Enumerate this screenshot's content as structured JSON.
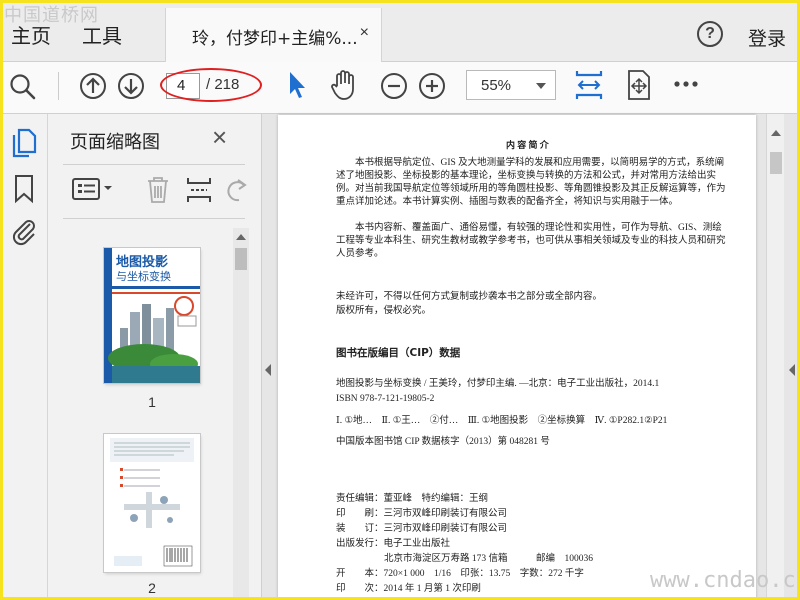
{
  "watermark_top": "中国道桥网",
  "watermark_bottom": "www.cndao.com",
  "menu": {
    "home": "主页",
    "tools": "工具",
    "login": "登录",
    "help_glyph": "?"
  },
  "tab": {
    "label": "玲，付梦印+主编%...",
    "close": "×"
  },
  "toolbar": {
    "current_page": "4",
    "total_pages": "/ 218",
    "zoom": "55%"
  },
  "panel": {
    "title": "页面缩略图",
    "close": "×",
    "thumb1_num": "1",
    "thumb2_num": "2"
  },
  "thumb1": {
    "title_line1": "地图投影",
    "title_line2": "与坐标变换"
  },
  "document": {
    "heading": "内 容 简 介",
    "para1": "本书根据导航定位、GIS 及大地测量学科的发展和应用需要，以简明易学的方式，系统阐述了地图投影、坐标投影的基本理论，坐标变换与转换的方法和公式，并对常用方法给出实例。对当前我国导航定位等领域所用的等角圆柱投影、等角圆锥投影及其正反解运算等，作为重点详加论述。本书计算实例、插图与数表的配备齐全，将知识与实用融于一体。",
    "para2": "本书内容新、覆盖面广、通俗易懂，有较强的理论性和实用性，可作为导航、GIS、测绘工程等专业本科生、研究生教材或教学参考书，也可供从事相关领域及专业的科技人员和研究人员参考。",
    "copy1": "未经许可，不得以任何方式复制或抄袭本书之部分或全部内容。",
    "copy2": "版权所有，侵权必究。",
    "cip_title": "图书在版编目（CIP）数据",
    "cip1": "地图投影与坐标变换 / 王美玲，付梦印主编. —北京：电子工业出版社，2014.1",
    "cip2": "ISBN 978-7-121-19805-2",
    "cip3": "Ⅰ. ①地…　Ⅱ. ①王…　②付…　Ⅲ. ①地图投影　②坐标换算　Ⅳ. ①P282.1②P21",
    "cip4": "中国版本图书馆 CIP 数据核字（2013）第 048281 号",
    "pub1": "责任编辑：董亚峰　特约编辑：王纲",
    "pub2": "印　　刷：三河市双峰印刷装订有限公司",
    "pub3": "装　　订：三河市双峰印刷装订有限公司",
    "pub4": "出版发行：电子工业出版社",
    "pub5": "北京市海淀区万寿路 173 信箱　　　邮编　100036",
    "pub6": "开　　本：720×1 000　1/16　印张：13.75　字数：272 千字",
    "pub7": "印　　次：2014 年 1 月第 1 次印刷"
  }
}
